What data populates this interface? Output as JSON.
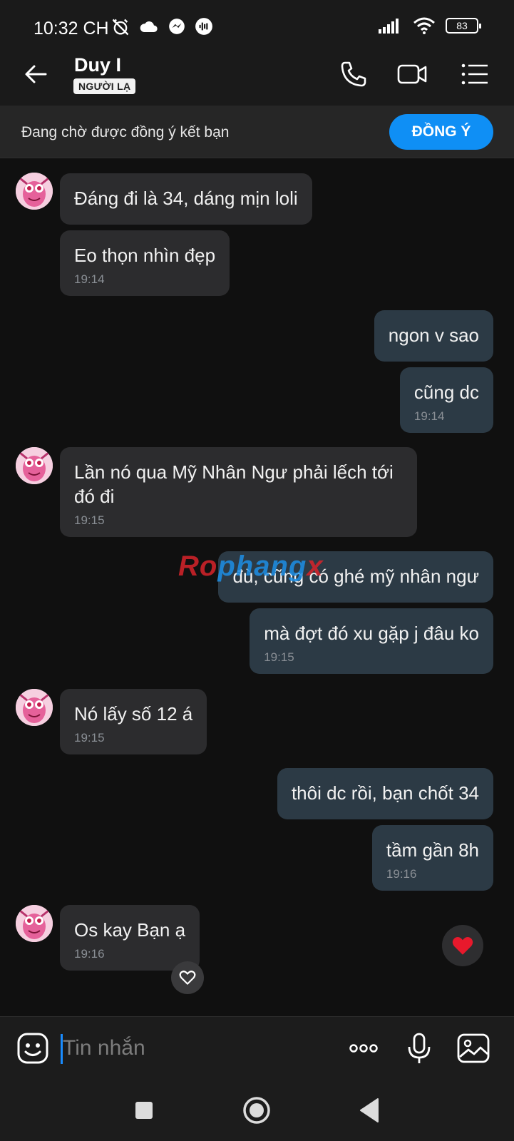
{
  "status_bar": {
    "time": "10:32 CH",
    "battery": "83"
  },
  "header": {
    "contact_name": "Duy I",
    "badge": "NGƯỜI LẠ",
    "icons": [
      "back-arrow-icon",
      "phone-icon",
      "video-call-icon",
      "menu-list-icon"
    ]
  },
  "friend_request": {
    "text": "Đang chờ được đồng ý kết bạn",
    "accept_label": "ĐỒNG Ý",
    "accent": "#0f8ff5"
  },
  "messages": [
    {
      "side": "in",
      "text": "Đáng đi là 34, dáng mịn loli",
      "time": ""
    },
    {
      "side": "in",
      "text": "Eo thọn nhìn đẹp",
      "time": "19:14"
    },
    {
      "side": "out",
      "text": "ngon v sao",
      "time": ""
    },
    {
      "side": "out",
      "text": "cũng dc",
      "time": "19:14"
    },
    {
      "side": "in",
      "text": "Lần nó qua Mỹ Nhân Ngư phải lếch tới đó đi",
      "time": "19:15"
    },
    {
      "side": "out",
      "text": "đù, cũng có ghé mỹ nhân ngư",
      "time": ""
    },
    {
      "side": "out",
      "text": "mà đợt đó xu gặp j đâu ko",
      "time": "19:15"
    },
    {
      "side": "in",
      "text": "Nó lấy số 12 á",
      "time": "19:15"
    },
    {
      "side": "out",
      "text": "thôi dc rồi, bạn chốt 34",
      "time": ""
    },
    {
      "side": "out",
      "text": "tầm gần 8h",
      "time": "19:16"
    },
    {
      "side": "in",
      "text": "Os kay Bạn ạ",
      "time": "19:16"
    }
  ],
  "watermark": {
    "part1": "Ro",
    "part2": "phang",
    "part3": "x"
  },
  "input": {
    "placeholder": "Tin nhắn",
    "icons": [
      "sticker-icon",
      "more-icon",
      "microphone-icon",
      "image-icon"
    ]
  },
  "colors": {
    "incoming_bubble": "#2c2c2e",
    "outgoing_bubble": "#2c3a45",
    "heart": "#e8192c"
  }
}
